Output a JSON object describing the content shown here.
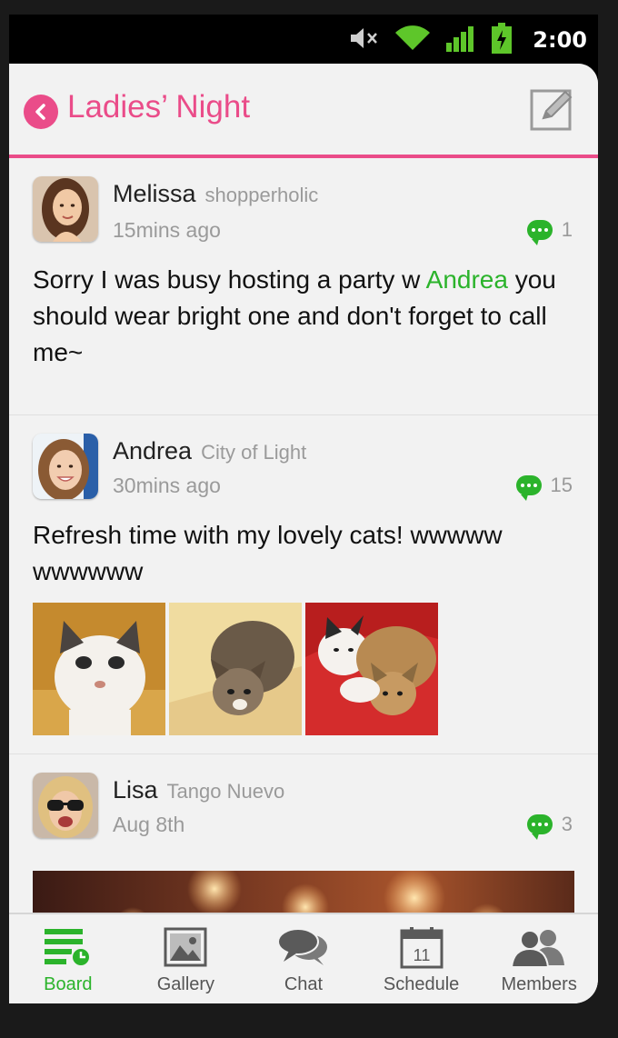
{
  "status_bar": {
    "time": "2:00"
  },
  "header": {
    "title": "Ladies’ Night"
  },
  "posts": [
    {
      "author": "Melissa",
      "tagline": "shopperholic",
      "time": "15mins ago",
      "comment_count": "1",
      "text_before": "Sorry I was busy hosting a party w ",
      "mention": "Andrea",
      "text_after": " you should wear bright one and don't forget to call me~"
    },
    {
      "author": "Andrea",
      "tagline": "City of Light",
      "time": "30mins ago",
      "comment_count": "15",
      "text": "Refresh time with my lovely cats! wwwww wwwwww"
    },
    {
      "author": "Lisa",
      "tagline": "Tango Nuevo",
      "time": "Aug 8th",
      "comment_count": "3"
    }
  ],
  "tabs": [
    {
      "label": "Board",
      "icon": "board-icon",
      "active": true
    },
    {
      "label": "Gallery",
      "icon": "gallery-icon",
      "active": false
    },
    {
      "label": "Chat",
      "icon": "chat-icon",
      "active": false
    },
    {
      "label": "Schedule",
      "icon": "calendar-icon",
      "active": false,
      "badge": "11"
    },
    {
      "label": "Members",
      "icon": "members-icon",
      "active": false
    }
  ],
  "colors": {
    "accent": "#ea4c89",
    "green": "#2bb32b",
    "background": "#f2f2f2"
  }
}
